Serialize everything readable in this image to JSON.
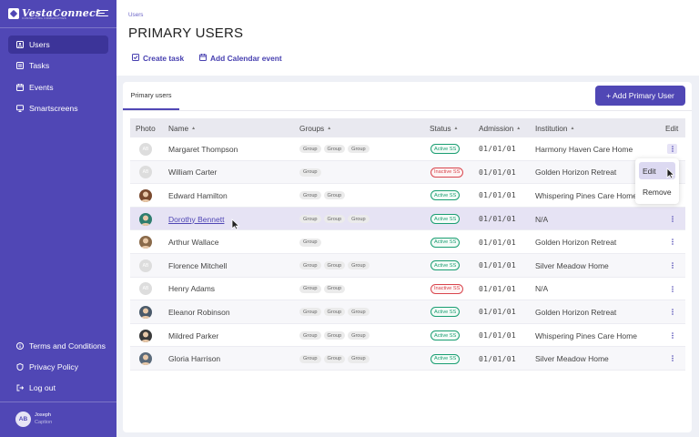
{
  "app": {
    "logo_text": "VestaConnect",
    "logo_tagline": "CONNECTING COMMUNITIES"
  },
  "sidebar": {
    "items": [
      {
        "label": "Users",
        "icon": "users-icon"
      },
      {
        "label": "Tasks",
        "icon": "list-icon"
      },
      {
        "label": "Events",
        "icon": "calendar-icon"
      },
      {
        "label": "Smartscreens",
        "icon": "monitor-icon"
      }
    ],
    "footer_items": [
      {
        "label": "Terms and Conditions",
        "icon": "info-icon"
      },
      {
        "label": "Privacy Policy",
        "icon": "shield-icon"
      },
      {
        "label": "Log out",
        "icon": "logout-icon"
      }
    ],
    "user": {
      "initials": "AB",
      "name": "Joseph",
      "caption": "Caption"
    }
  },
  "header": {
    "breadcrumb": "Users",
    "title": "PRIMARY USERS",
    "actions": {
      "create_task": "Create task",
      "add_event": "Add Calendar event"
    }
  },
  "tabs": {
    "active": "Primary users"
  },
  "add_button": "+ Add Primary User",
  "table": {
    "columns": {
      "photo": "Photo",
      "name": "Name",
      "groups": "Groups",
      "status": "Status",
      "admission": "Admission",
      "institution": "Institution",
      "edit": "Edit"
    },
    "rows": [
      {
        "name": "Margaret Thompson",
        "avatar": "AB",
        "groups": [
          "Group",
          "Group",
          "Group"
        ],
        "status": "Active SS",
        "admission": "01/01/01",
        "institution": "Harmony Haven Care Home"
      },
      {
        "name": "William Carter",
        "avatar": "AB",
        "groups": [
          "Group"
        ],
        "status": "Inactive SS",
        "admission": "01/01/01",
        "institution": "Golden Horizon Retreat"
      },
      {
        "name": "Edward Hamilton",
        "avatar": "",
        "groups": [
          "Group",
          "Group"
        ],
        "status": "Active SS",
        "admission": "01/01/01",
        "institution": "Whispering Pines Care Home"
      },
      {
        "name": "Dorothy Bennett",
        "avatar": "",
        "groups": [
          "Group",
          "Group",
          "Group"
        ],
        "status": "Active SS",
        "admission": "01/01/01",
        "institution": "N/A"
      },
      {
        "name": "Arthur Wallace",
        "avatar": "",
        "groups": [
          "Group"
        ],
        "status": "Active SS",
        "admission": "01/01/01",
        "institution": "Golden Horizon Retreat"
      },
      {
        "name": "Florence Mitchell",
        "avatar": "AB",
        "groups": [
          "Group",
          "Group",
          "Group"
        ],
        "status": "Active SS",
        "admission": "01/01/01",
        "institution": "Silver Meadow Home"
      },
      {
        "name": "Henry Adams",
        "avatar": "AB",
        "groups": [
          "Group",
          "Group"
        ],
        "status": "Inactive SS",
        "admission": "01/01/01",
        "institution": "N/A"
      },
      {
        "name": "Eleanor Robinson",
        "avatar": "",
        "groups": [
          "Group",
          "Group",
          "Group"
        ],
        "status": "Active SS",
        "admission": "01/01/01",
        "institution": "Golden Horizon Retreat"
      },
      {
        "name": "Mildred Parker",
        "avatar": "",
        "groups": [
          "Group",
          "Group",
          "Group"
        ],
        "status": "Active SS",
        "admission": "01/01/01",
        "institution": "Whispering Pines Care Home"
      },
      {
        "name": "Gloria Harrison",
        "avatar": "",
        "groups": [
          "Group",
          "Group",
          "Group"
        ],
        "status": "Active SS",
        "admission": "01/01/01",
        "institution": "Silver Meadow Home"
      }
    ]
  },
  "context_menu": {
    "edit": "Edit",
    "remove": "Remove"
  },
  "colors": {
    "primary": "#5047b5",
    "active": "#1a9e72",
    "inactive": "#d9454d"
  }
}
